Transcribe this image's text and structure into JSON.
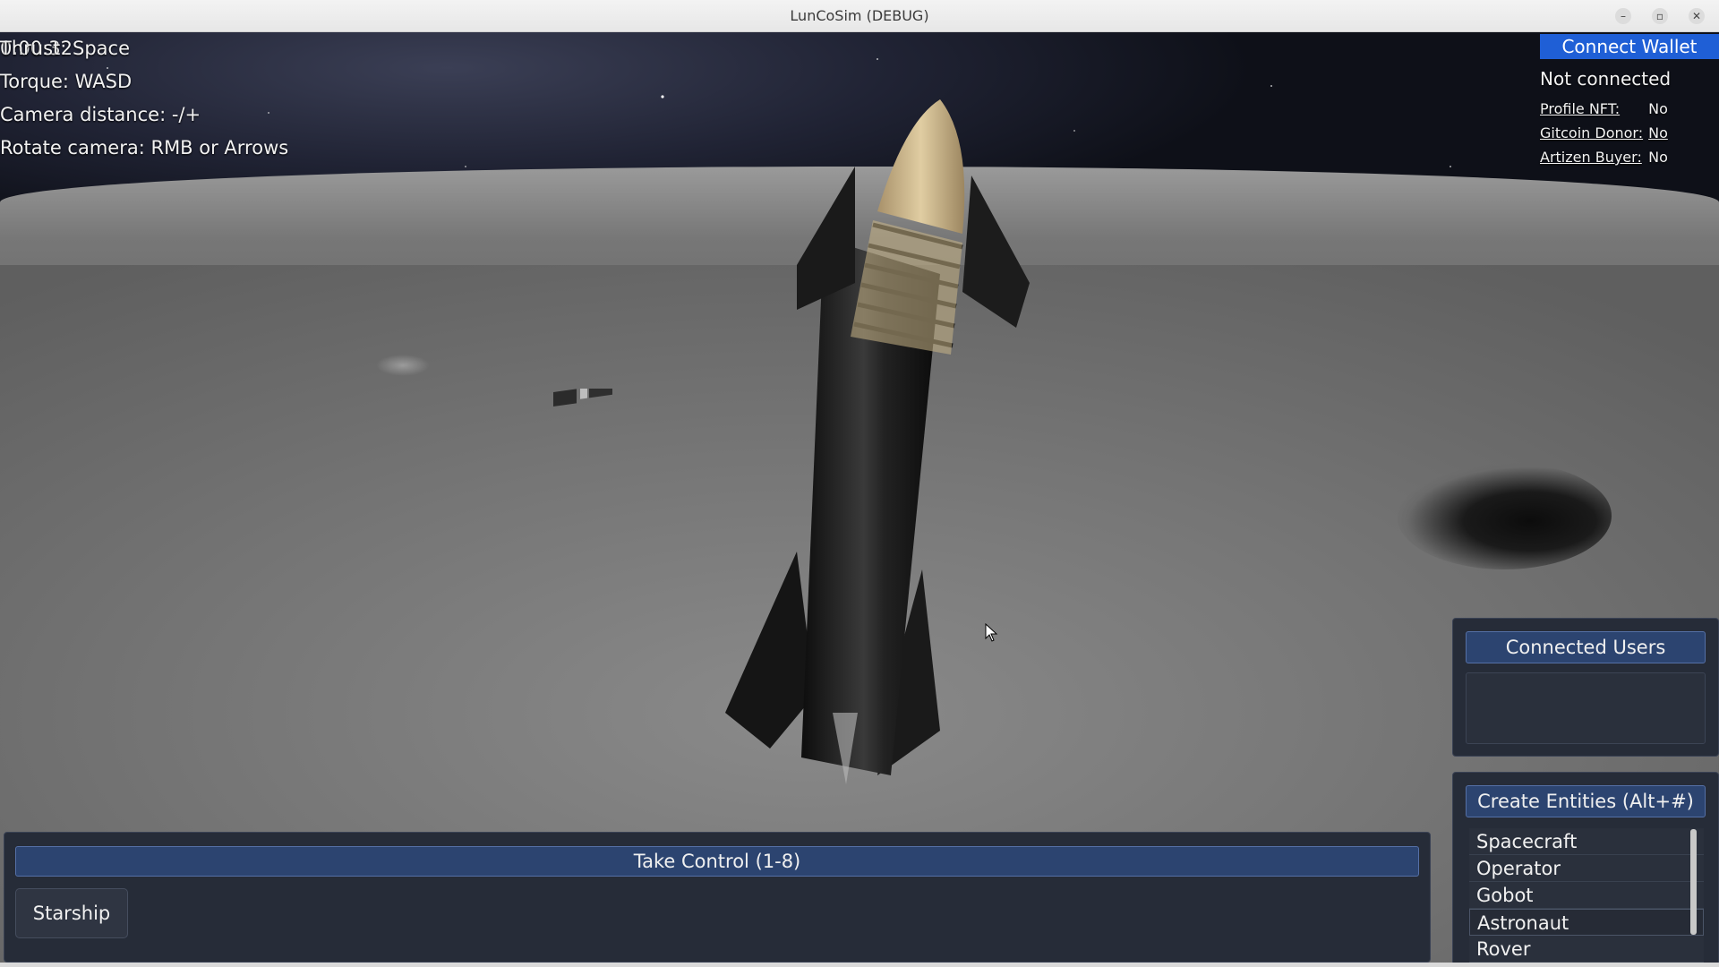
{
  "window": {
    "title": "LunCoSim (DEBUG)",
    "minimize_icon": "minimize-icon",
    "maximize_icon": "maximize-icon",
    "close_icon": "close-icon"
  },
  "hud": {
    "line1_a": "0:00:32",
    "line1_b": "Thrust: Space",
    "line2": "Torque: WASD",
    "line3": "Camera distance: -/+",
    "line4": "Rotate camera: RMB or Arrows"
  },
  "wallet": {
    "connect_label": "Connect Wallet",
    "status": "Not connected",
    "rows": [
      {
        "label": "Profile NFT:",
        "value": "No"
      },
      {
        "label": "Gitcoin Donor:",
        "value": "No"
      },
      {
        "label": "Artizen Buyer:",
        "value": "No"
      }
    ]
  },
  "users_panel": {
    "title": "Connected Users"
  },
  "entities_panel": {
    "title": "Create Entities (Alt+#)",
    "items": [
      "Spacecraft",
      "Operator",
      "Gobot",
      "Astronaut",
      "Rover"
    ],
    "selected": "Astronaut"
  },
  "control_panel": {
    "title": "Take Control (1-8)",
    "entity_button": "Starship"
  },
  "colors": {
    "accent_blue": "#1f5fd6",
    "panel_bg": "#262c38",
    "header_bg": "#2c4470"
  }
}
